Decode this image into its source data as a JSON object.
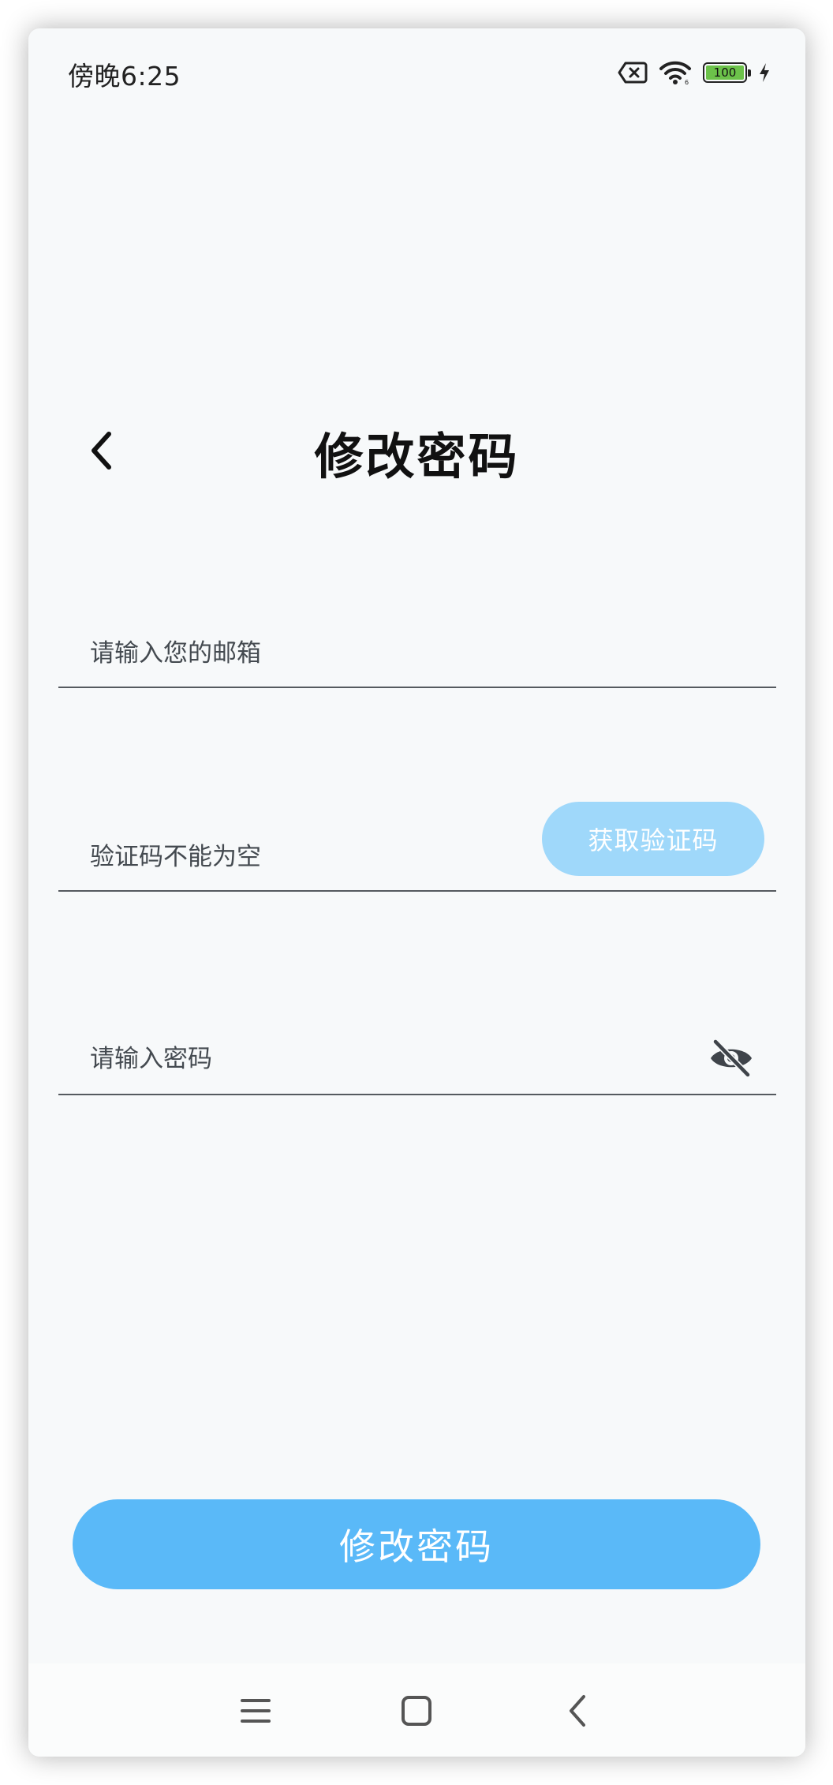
{
  "status_bar": {
    "time": "傍晚6:25",
    "battery_level": "100",
    "icons": [
      "sim-error-icon",
      "wifi-icon",
      "battery-icon",
      "charging-icon"
    ]
  },
  "header": {
    "back_icon": "chevron-left-icon",
    "title": "修改密码"
  },
  "form": {
    "email": {
      "placeholder": "请输入您的邮箱",
      "value": ""
    },
    "code": {
      "placeholder": "验证码不能为空",
      "value": "",
      "button_label": "获取验证码"
    },
    "password": {
      "placeholder": "请输入密码",
      "value": "",
      "visibility_icon": "eye-off-icon"
    },
    "submit_label": "修改密码"
  },
  "nav_bar": {
    "items": [
      "menu-icon",
      "home-icon",
      "back-icon"
    ]
  },
  "colors": {
    "background": "#f7f9fa",
    "code_button": "#9fd8fa",
    "submit_button": "#5ab9f8",
    "divider": "#555a5f"
  }
}
